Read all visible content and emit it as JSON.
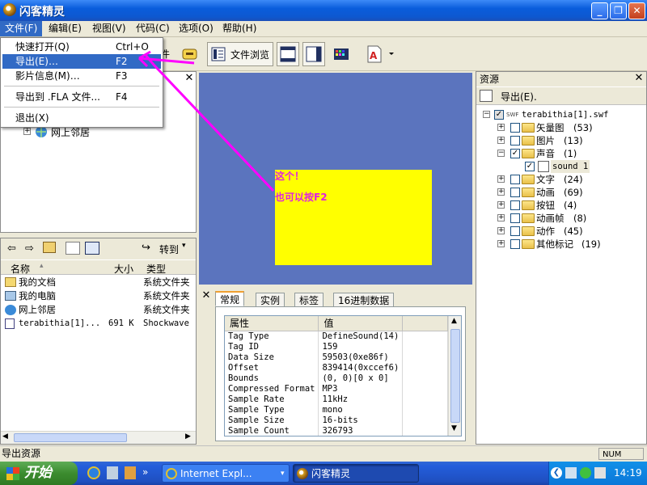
{
  "window": {
    "title": "闪客精灵"
  },
  "menubar": [
    {
      "label": "文件(F)"
    },
    {
      "label": "编辑(E)"
    },
    {
      "label": "视图(V)"
    },
    {
      "label": "代码(C)"
    },
    {
      "label": "选项(O)"
    },
    {
      "label": "帮助(H)"
    }
  ],
  "file_menu": {
    "items": [
      {
        "label": "快速打开(Q)",
        "shortcut": "Ctrl+O"
      },
      {
        "label": "导出(E)…",
        "shortcut": "F2"
      },
      {
        "label": "影片信息(M)…",
        "shortcut": "F3"
      },
      {
        "label": "导出到 .FLA 文件...",
        "shortcut": "F4"
      },
      {
        "label": "退出(X)",
        "shortcut": ""
      }
    ]
  },
  "toolbar": {
    "partial_label": "件",
    "browse_label": "文件浏览"
  },
  "left_tree": {
    "item": "网上邻居"
  },
  "file_list": {
    "nav_label": "转到",
    "columns": [
      "名称",
      "大小",
      "类型"
    ],
    "rows": [
      {
        "name": "我的文档",
        "size": "",
        "type": "系统文件夹"
      },
      {
        "name": "我的电脑",
        "size": "",
        "type": "系统文件夹"
      },
      {
        "name": "网上邻居",
        "size": "",
        "type": "系统文件夹"
      },
      {
        "name": "terabithia[1]...",
        "size": "691 K",
        "type": "Shockwave F"
      }
    ]
  },
  "stage": {
    "annotation_1": "这个！",
    "annotation_2": "也可以按F2",
    "bg_color": "#5b74be",
    "rect_color": "#ffff00"
  },
  "properties": {
    "tabs": [
      "常规",
      "实例",
      "标签",
      "16进制数据"
    ],
    "headers": [
      "属性",
      "值"
    ],
    "rows": [
      {
        "k": "Tag Type",
        "v": "DefineSound(14)"
      },
      {
        "k": "Tag ID",
        "v": "159"
      },
      {
        "k": "Data Size",
        "v": "59503(0xe86f)"
      },
      {
        "k": "Offset",
        "v": "839414(0xccef6)"
      },
      {
        "k": "Bounds",
        "v": "(0, 0)[0 x 0]"
      },
      {
        "k": "Compressed Format",
        "v": "MP3"
      },
      {
        "k": "Sample Rate",
        "v": "11kHz"
      },
      {
        "k": "Sample Type",
        "v": "mono"
      },
      {
        "k": "Sample Size",
        "v": "16-bits"
      },
      {
        "k": "Sample Count",
        "v": "326793"
      }
    ]
  },
  "resources": {
    "title": "资源",
    "export_label": "导出(E).",
    "root": "terabithia[1].swf",
    "items": [
      {
        "label": "矢量图",
        "count": "(53)",
        "checked": false
      },
      {
        "label": "图片",
        "count": "(13)",
        "checked": false
      },
      {
        "label": "声音",
        "count": "(1)",
        "checked": true
      },
      {
        "label": "sound 1",
        "count": "",
        "checked": true
      },
      {
        "label": "文字",
        "count": "(24)",
        "checked": false
      },
      {
        "label": "动画",
        "count": "(69)",
        "checked": false
      },
      {
        "label": "按钮",
        "count": "(4)",
        "checked": false
      },
      {
        "label": "动画帧",
        "count": "(8)",
        "checked": false
      },
      {
        "label": "动作",
        "count": "(45)",
        "checked": false
      },
      {
        "label": "其他标记",
        "count": "(19)",
        "checked": false
      }
    ]
  },
  "statusbar": {
    "text": "导出资源",
    "num": "NUM"
  },
  "taskbar": {
    "start": "开始",
    "tasks": [
      "Internet Expl...",
      "闪客精灵"
    ],
    "clock": "14:19"
  },
  "colors": {
    "accent": "#316ac5",
    "annotation": "#e020e0"
  }
}
